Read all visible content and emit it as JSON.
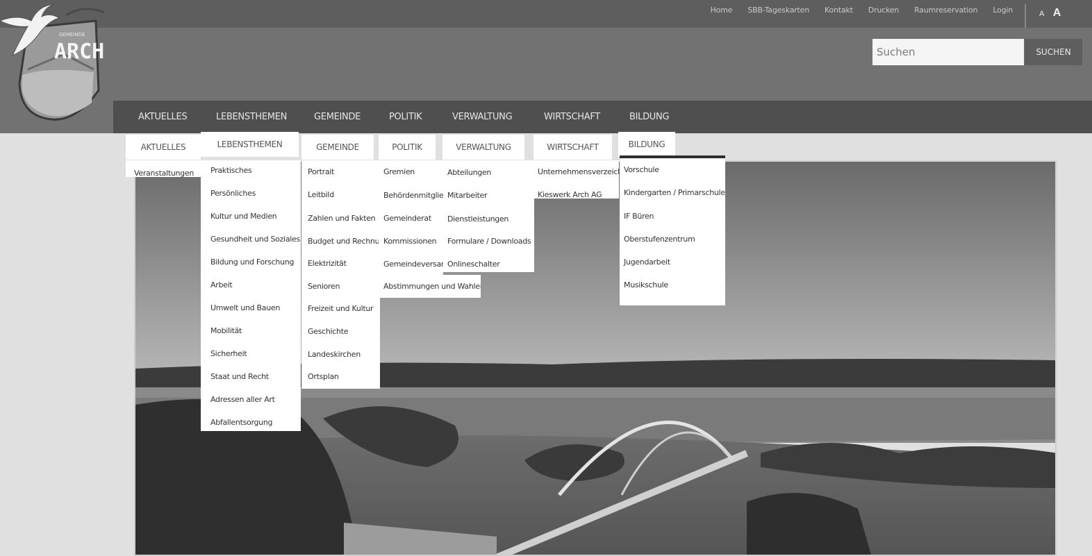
{
  "logo": {
    "name": "ARCH",
    "small_text": "GEMEINDE"
  },
  "utility_links": [
    "Home",
    "SBB-Tageskarten",
    "Kontakt",
    "Drucken",
    "Raumreservation",
    "Login"
  ],
  "font_size": {
    "small": "A",
    "large": "A"
  },
  "search": {
    "placeholder": "Suchen",
    "button": "SUCHEN"
  },
  "main_nav": [
    "AKTUELLES",
    "LEBENSTHEMEN",
    "GEMEINDE",
    "POLITIK",
    "VERWALTUNG",
    "WIRTSCHAFT",
    "BILDUNG"
  ],
  "menus": {
    "aktuelles": [
      "Veranstaltungen"
    ],
    "lebensthemen": [
      "Praktisches",
      "Persönliches",
      "Kultur und Medien",
      "Gesundheit und Soziales",
      "Bildung und Forschung",
      "Arbeit",
      "Umwelt und Bauen",
      "Mobilität",
      "Sicherheit",
      "Staat und Recht",
      "Adressen aller Art",
      "Abfallentsorgung"
    ],
    "gemeinde": [
      "Portrait",
      "Leitbild",
      "Zahlen und Fakten",
      "Budget und Rechnung",
      "Elektrizität",
      "Senioren",
      "Freizeit und Kultur",
      "Geschichte",
      "Landeskirchen",
      "Ortsplan"
    ],
    "politik": [
      "Gremien",
      "Behördenmitglieder",
      "Gemeinderat",
      "Kommissionen",
      "Gemeindeversammlung",
      "Abstimmungen und Wahlen"
    ],
    "verwaltung": [
      "Abteilungen",
      "Mitarbeiter",
      "Dienstleistungen",
      "Formulare / Downloads",
      "Onlineschalter"
    ],
    "wirtschaft": [
      "Unternehmensverzeichnis",
      "Kieswerk Arch AG"
    ],
    "bildung": [
      "Vorschule",
      "Kindergarten / Primarschule",
      "IF Büren",
      "Oberstufenzentrum",
      "Jugendarbeit",
      "Musikschule"
    ]
  }
}
